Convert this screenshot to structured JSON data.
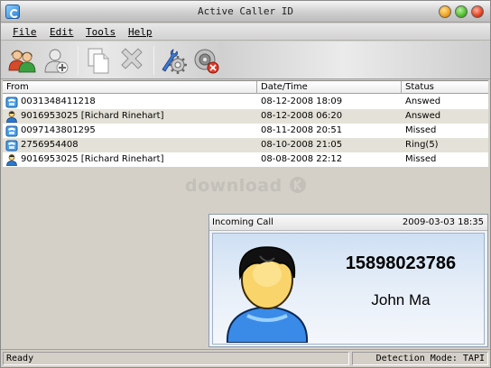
{
  "window": {
    "title": "Active Caller ID"
  },
  "menu": [
    {
      "label": "File"
    },
    {
      "label": "Edit"
    },
    {
      "label": "Tools"
    },
    {
      "label": "Help"
    }
  ],
  "toolbar": {
    "icons": [
      "contacts-icon",
      "add-contact-icon",
      "copy-icon",
      "delete-icon",
      "settings-icon",
      "disconnect-icon"
    ]
  },
  "list": {
    "columns": [
      "From",
      "Date/Time",
      "Status"
    ],
    "rows": [
      {
        "from": "0031348411218",
        "datetime": "08-12-2008 18:09",
        "status": "Answed",
        "icon": "phone-icon"
      },
      {
        "from": "9016953025 [Richard Rinehart]",
        "datetime": "08-12-2008 06:20",
        "status": "Answed",
        "icon": "person-icon"
      },
      {
        "from": "0097143801295",
        "datetime": "08-11-2008 20:51",
        "status": "Missed",
        "icon": "phone-icon"
      },
      {
        "from": "2756954408",
        "datetime": "08-10-2008 21:05",
        "status": "Ring(5)",
        "icon": "phone-icon"
      },
      {
        "from": "9016953025 [Richard Rinehart]",
        "datetime": "08-08-2008 22:12",
        "status": "Missed",
        "icon": "person-icon"
      }
    ]
  },
  "watermark": "download",
  "incoming_call": {
    "title": "Incoming Call",
    "time": "2009-03-03 18:35",
    "number": "15898023786",
    "name": "John Ma"
  },
  "status": {
    "left": "Ready",
    "right": "Detection Mode: TAPI"
  }
}
